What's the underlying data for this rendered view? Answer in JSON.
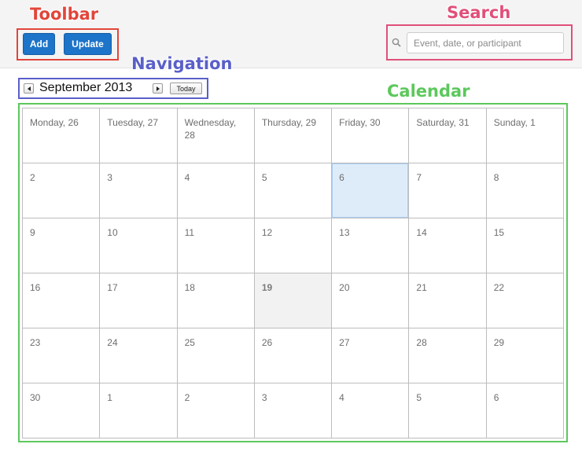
{
  "callouts": {
    "toolbar": "Toolbar",
    "search": "Search",
    "navigation": "Navigation",
    "calendar": "Calendar",
    "colors": {
      "toolbar": "#e2453a",
      "search": "#e0507a",
      "navigation": "#5a5fc9",
      "calendar": "#5cc85c"
    }
  },
  "toolbar": {
    "add_label": "Add",
    "update_label": "Update"
  },
  "search": {
    "placeholder": "Event, date, or participant",
    "value": ""
  },
  "navigation": {
    "month_title": "September 2013",
    "today_label": "Today"
  },
  "calendar": {
    "selected_day": "6",
    "current_day": "19",
    "weeks": [
      [
        "Monday, 26",
        "Tuesday, 27",
        "Wednesday, 28",
        "Thursday, 29",
        "Friday, 30",
        "Saturday, 31",
        "Sunday, 1"
      ],
      [
        "2",
        "3",
        "4",
        "5",
        "6",
        "7",
        "8"
      ],
      [
        "9",
        "10",
        "11",
        "12",
        "13",
        "14",
        "15"
      ],
      [
        "16",
        "17",
        "18",
        "19",
        "20",
        "21",
        "22"
      ],
      [
        "23",
        "24",
        "25",
        "26",
        "27",
        "28",
        "29"
      ],
      [
        "30",
        "1",
        "2",
        "3",
        "4",
        "5",
        "6"
      ]
    ]
  },
  "icons": {
    "search": "search-icon",
    "prev": "chevron-left-icon",
    "next": "chevron-right-icon"
  },
  "colors": {
    "button_blue": "#1d74c9",
    "selected_cell": "#deecfa",
    "today_cell": "#f2f2f2"
  }
}
